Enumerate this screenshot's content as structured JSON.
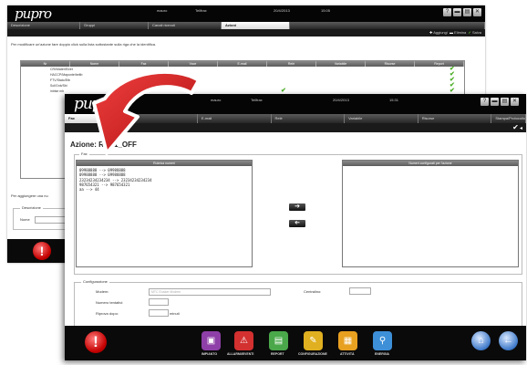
{
  "back": {
    "logo": "pupro",
    "header_user": "mauro",
    "header_mode": "Tellfrax",
    "header_date": "20/4/2013",
    "header_time": "15:05",
    "tabs": [
      "Descrizione",
      "Gruppi",
      "Canali ricevuti",
      "Azioni"
    ],
    "active_tab": 3,
    "toolbar": {
      "add": "Aggiungi",
      "remove": "Elimina",
      "save": "Salva"
    },
    "hint": "Per modificare un'azione fare doppio click sulla lista sottostante sulla riga che la identifica.",
    "table": {
      "headers": [
        "Nr",
        "Nome",
        "Fax",
        "Voce",
        "E-mail",
        "Relè",
        "Variabile",
        "Risorse",
        "Report"
      ],
      "rows": [
        {
          "name": "CRI/Mater/Elvet"
        },
        {
          "name": "HACCP/Maponte/beltb"
        },
        {
          "name": "FTV/Stato/Etb"
        },
        {
          "name": "Sol/Gnb/Sbi"
        },
        {
          "name": "intrise mb"
        }
      ]
    },
    "add_hint": "Per aggiungere una nu",
    "form_legend": "Descrizione",
    "form_name_label": "Nome"
  },
  "front": {
    "logo": "pupro",
    "header_user": "mauro",
    "header_mode": "Tellfrax",
    "header_date": "20/4/2013",
    "header_time": "15:31",
    "tabs": [
      "Fax",
      "",
      "E-mail",
      "Relè",
      "Variabile",
      "Risorse",
      "Stampa/Protocollo"
    ],
    "action_title": "Azione: Rele1_OFF",
    "fax_legend": "Fax",
    "left_list_header": "Rubrica numeri",
    "left_list": [
      "09988888 --> 09988888",
      "09988888 --> 09988888",
      "23234234234234 --> 23234234234234",
      "987654321 --> 987654321",
      "aa --> 44"
    ],
    "right_list_header": "Numeri configurati per l'azione",
    "config_legend": "Configurazione",
    "modem_label": "Modem:",
    "modem_value": "MTC Eusker Modem",
    "centralino_label": "Centralino:",
    "tentativi_label": "Numero tentativi:",
    "riprova_label": "Riprova dopo:",
    "riprova_unit": "minuti",
    "bottom_nav": [
      {
        "label": "IMPIANTO",
        "icon": "plant-icon",
        "color": "#8e3fa8",
        "glyph": "▣"
      },
      {
        "label": "ALLARMI/EVENTI",
        "icon": "alarm-icon",
        "color": "#d33030",
        "glyph": "⚠"
      },
      {
        "label": "REPORT",
        "icon": "report-icon",
        "color": "#4aa84a",
        "glyph": "▤"
      },
      {
        "label": "CONFIGURAZIONE",
        "icon": "config-icon",
        "color": "#e0b020",
        "glyph": "✎"
      },
      {
        "label": "ATTIVITÀ",
        "icon": "activity-icon",
        "color": "#e8a020",
        "glyph": "▦"
      },
      {
        "label": "ENERGIA",
        "icon": "energy-icon",
        "color": "#3d8fd8",
        "glyph": "⚲"
      }
    ]
  },
  "colors": {
    "arrow": "#d21f1f",
    "check": "#4caf26",
    "alert": "#c40000"
  }
}
